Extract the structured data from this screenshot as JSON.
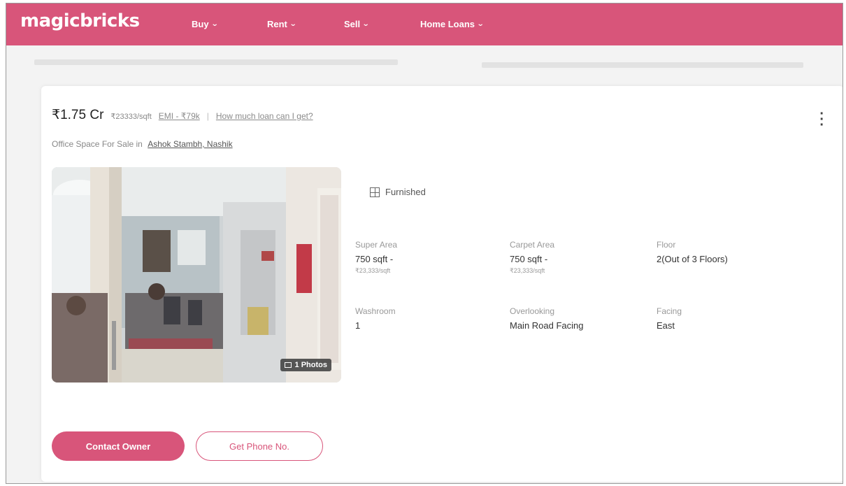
{
  "brand": {
    "name": "magicbricks",
    "color": "#d8557a"
  },
  "nav": {
    "items": [
      {
        "label": "Buy",
        "icon": "chevron-down-icon"
      },
      {
        "label": "Rent",
        "icon": "chevron-down-icon"
      },
      {
        "label": "Sell",
        "icon": "chevron-down-icon"
      },
      {
        "label": "Home Loans",
        "icon": "chevron-down-icon"
      }
    ]
  },
  "listing": {
    "price": "₹1.75 Cr",
    "price_per_sqft": "₹23333/sqft",
    "emi": "EMI - ₹79k",
    "separator": "|",
    "loan_link": "How much loan can I get?",
    "subtitle_prefix": "Office Space For Sale in",
    "locality": "Ashok Stambh, Nashik",
    "photo_count": "1 Photos",
    "furnishing": "Furnished",
    "specs": [
      {
        "label": "Super Area",
        "value": "750 sqft -",
        "sub": "₹23,333/sqft"
      },
      {
        "label": "Carpet Area",
        "value": "750 sqft -",
        "sub": "₹23,333/sqft"
      },
      {
        "label": "Floor",
        "value": "2(Out of 3 Floors)"
      },
      {
        "label": "Washroom",
        "value": "1"
      },
      {
        "label": "Overlooking",
        "value": "Main Road Facing"
      },
      {
        "label": "Facing",
        "value": "East"
      }
    ]
  },
  "actions": {
    "contact_owner": "Contact Owner",
    "get_phone": "Get Phone No."
  }
}
